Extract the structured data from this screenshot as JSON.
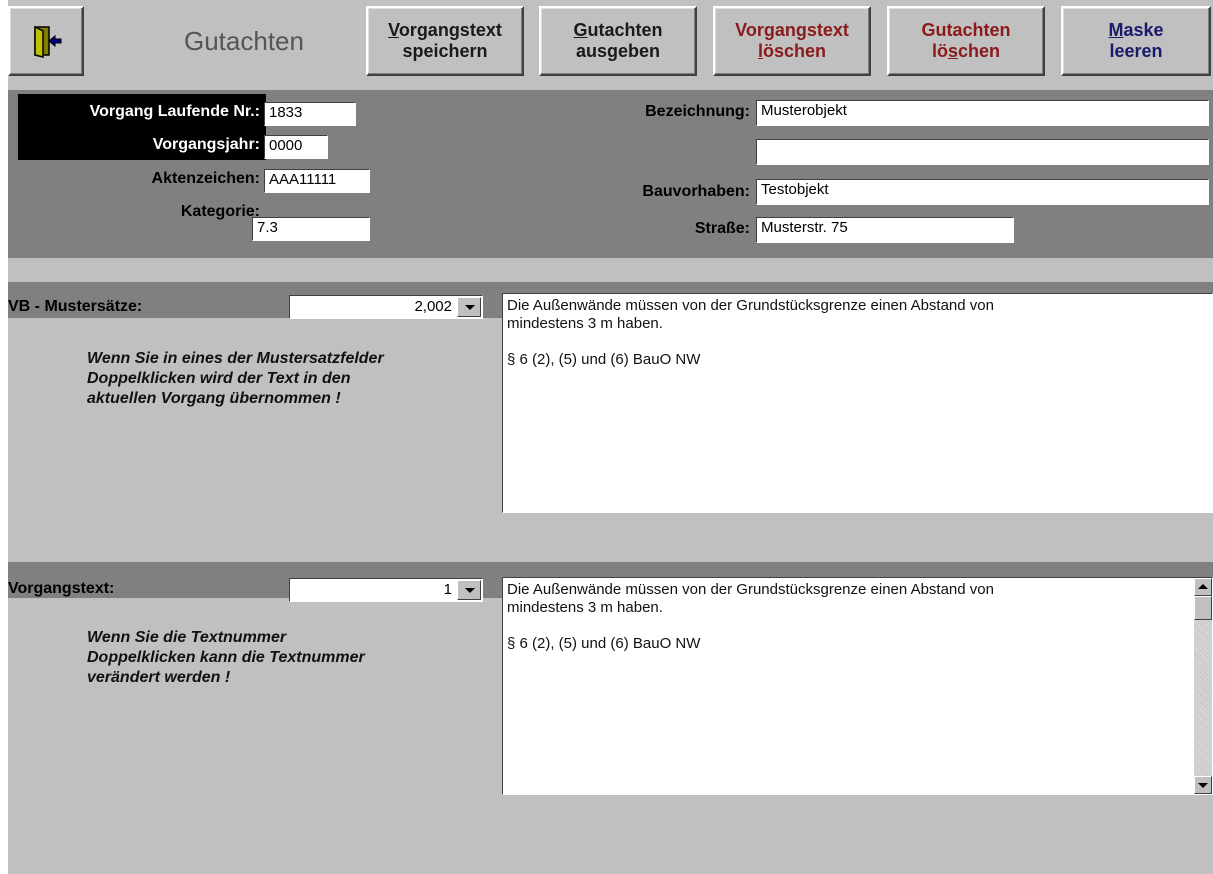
{
  "toolbar": {
    "title": "Gutachten",
    "save_text": {
      "pre": "",
      "key": "V",
      "rest1": "organgstext",
      "line2": "speichern"
    },
    "export": {
      "pre": "",
      "key": "G",
      "rest1": "utachten",
      "line2": "ausgeben"
    },
    "delete_text": {
      "line1": "Vorgangstext",
      "l2pre": "",
      "key": "l",
      "l2rest": "öschen"
    },
    "delete_report": {
      "line1": "Gutachten",
      "l2pre": "lö",
      "key": "s",
      "l2rest": "chen"
    },
    "clear": {
      "pre": "",
      "key": "M",
      "rest1": "aske",
      "line2": "leeren"
    }
  },
  "colors": {
    "red_button_text": "#8b1a1a",
    "blue_button_text": "#1a1a6b"
  },
  "form": {
    "laufende_nr_label": "Vorgang Laufende Nr.:",
    "laufende_nr": "1833",
    "vorgangsjahr_label": "Vorgangsjahr:",
    "vorgangsjahr": "0000",
    "aktenzeichen_label": "Aktenzeichen:",
    "aktenzeichen": "AAA11111",
    "kategorie_label": "Kategorie:",
    "kategorie": "7.3",
    "bezeichnung_label": "Bezeichnung:",
    "bezeichnung": "Musterobjekt",
    "bezeichnung2": "",
    "bauvorhaben_label": "Bauvorhaben:",
    "bauvorhaben": "Testobjekt",
    "strasse_label": "Straße:",
    "strasse": "Musterstr. 75"
  },
  "mustersaetze": {
    "label": "VB - Mustersätze:",
    "value": "2,002",
    "hint": [
      "Wenn Sie in eines der Mustersatzfelder",
      "Doppelklicken wird der Text in den",
      "aktuellen Vorgang übernommen !"
    ],
    "text": [
      "Die Außenwände müssen von der Grundstücksgrenze einen Abstand von",
      "mindestens 3 m haben.",
      "",
      "§ 6 (2), (5) und (6) BauO NW"
    ]
  },
  "vorgangstext": {
    "label": "Vorgangstext:",
    "value": "1",
    "hint": [
      "Wenn Sie die Textnummer",
      "Doppelklicken kann die Textnummer",
      "verändert werden !"
    ],
    "text": [
      "Die Außenwände müssen von der Grundstücksgrenze einen Abstand von",
      "mindestens 3 m haben.",
      "",
      "§ 6 (2), (5) und (6) BauO NW"
    ]
  }
}
